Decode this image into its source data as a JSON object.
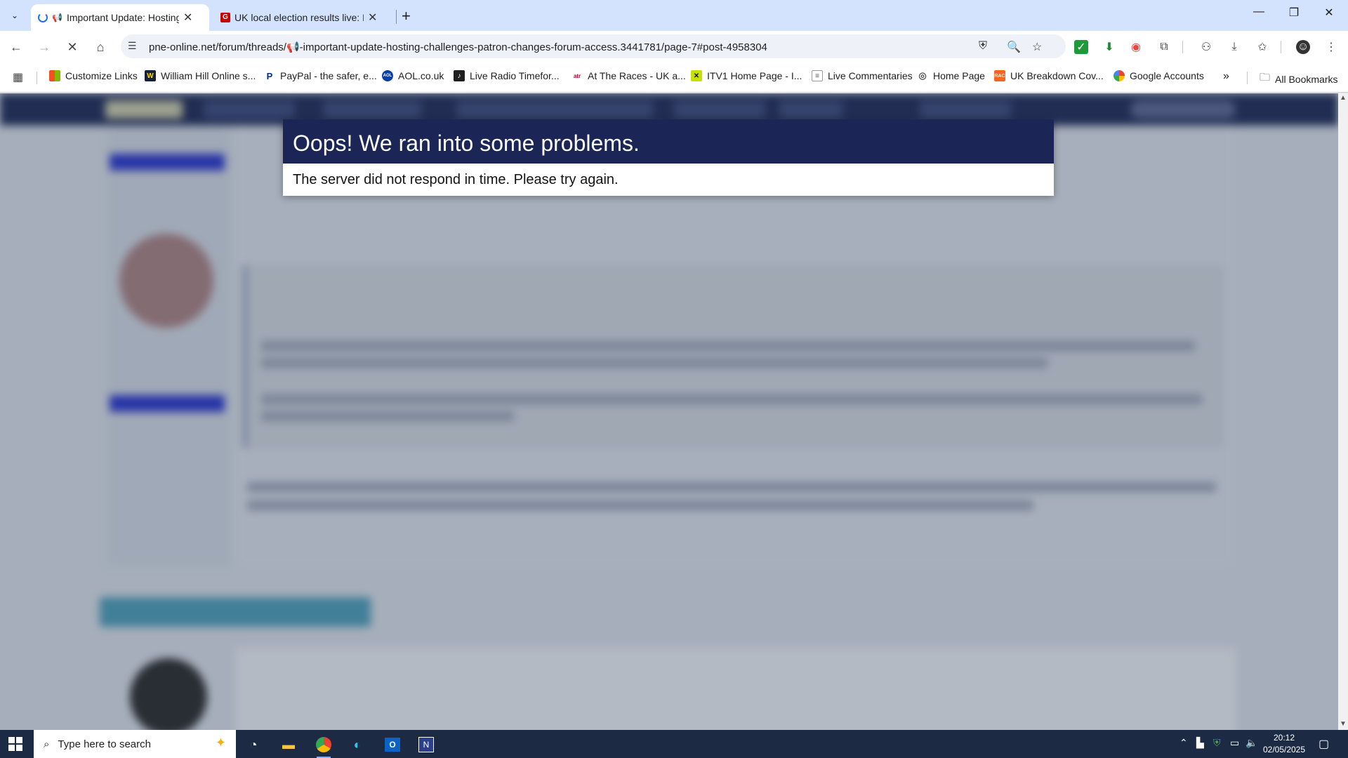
{
  "tabs": [
    {
      "title": "Important Update: Hosting",
      "active": true,
      "loading": true
    },
    {
      "title": "UK local election results live: Hu",
      "active": false
    }
  ],
  "omnibox": {
    "url": "pne-online.net/forum/threads/📢-important-update-hosting-challenges-patron-changes-forum-access.3441781/page-7#post-4958304"
  },
  "bookmarks": [
    {
      "label": "Customize Links",
      "icon": "windows-grid-icon"
    },
    {
      "label": "William Hill Online s...",
      "icon": "william-hill-icon"
    },
    {
      "label": "PayPal - the safer, e...",
      "icon": "paypal-icon"
    },
    {
      "label": "AOL.co.uk",
      "icon": "aol-icon"
    },
    {
      "label": "Live Radio Timefor...",
      "icon": "radio-icon"
    },
    {
      "label": "At The Races - UK a...",
      "icon": "atr-icon"
    },
    {
      "label": "ITV1 Home Page - I...",
      "icon": "itv-icon"
    },
    {
      "label": "Live Commentaries",
      "icon": "page-icon"
    },
    {
      "label": "Home Page",
      "icon": "globe-icon"
    },
    {
      "label": "UK Breakdown Cov...",
      "icon": "rac-icon"
    },
    {
      "label": "Google Accounts",
      "icon": "google-icon"
    }
  ],
  "all_bookmarks": "All Bookmarks",
  "modal": {
    "title": "Oops! We ran into some problems.",
    "message": "The server did not respond in time. Please try again."
  },
  "taskbar": {
    "search_placeholder": "Type here to search",
    "time": "20:12",
    "date": "02/05/2025"
  }
}
